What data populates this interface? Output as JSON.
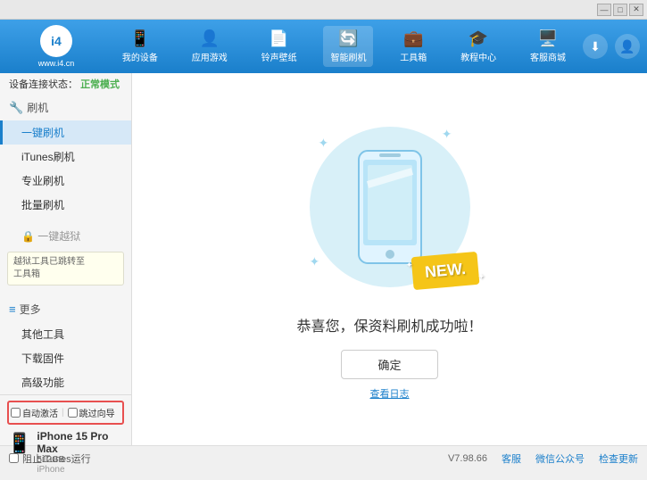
{
  "titlebar": {
    "btn_minimize": "—",
    "btn_restore": "□",
    "btn_close": "✕"
  },
  "header": {
    "logo_abbr": "i4",
    "logo_url": "www.i4.cn",
    "nav_items": [
      {
        "id": "my-device",
        "label": "我的设备",
        "icon": "📱"
      },
      {
        "id": "app-games",
        "label": "应用游戏",
        "icon": "👤"
      },
      {
        "id": "ringtone",
        "label": "铃声壁纸",
        "icon": "📄"
      },
      {
        "id": "smart-flash",
        "label": "智能刷机",
        "icon": "🔄",
        "active": true
      },
      {
        "id": "toolbox",
        "label": "工具箱",
        "icon": "💼"
      },
      {
        "id": "tutorial",
        "label": "教程中心",
        "icon": "🎓"
      },
      {
        "id": "service",
        "label": "客服商城",
        "icon": "🖥️"
      }
    ],
    "download_icon": "⬇",
    "user_icon": "👤"
  },
  "breadcrumb": {
    "label": "设备连接状态：",
    "status": "正常模式"
  },
  "sidebar": {
    "section_flash": {
      "label": "刷机",
      "icon": "🔧"
    },
    "items": [
      {
        "id": "one-key-flash",
        "label": "一键刷机",
        "active": true
      },
      {
        "id": "itunes-flash",
        "label": "iTunes刷机"
      },
      {
        "id": "pro-flash",
        "label": "专业刷机"
      },
      {
        "id": "batch-flash",
        "label": "批量刷机"
      }
    ],
    "disabled_item": {
      "label": "一键越狱",
      "icon": "🔒"
    },
    "disabled_note": "越狱工具已跳转至\n工具箱",
    "section_more": {
      "label": "更多",
      "icon": "≡"
    },
    "more_items": [
      {
        "id": "other-tools",
        "label": "其他工具"
      },
      {
        "id": "download-firmware",
        "label": "下载固件"
      },
      {
        "id": "advanced",
        "label": "高级功能"
      }
    ],
    "auto_activate_label": "自动激活",
    "auto_guide_label": "跳过向导",
    "device": {
      "name": "iPhone 15 Pro Max",
      "storage": "512GB",
      "type": "iPhone"
    }
  },
  "content": {
    "new_badge": "NEW.",
    "success_message": "恭喜您，保资料刷机成功啦！",
    "confirm_btn": "确定",
    "log_link": "查看日志"
  },
  "statusbar": {
    "stop_itunes_label": "阻止iTunes运行",
    "version": "V7.98.66",
    "link1": "客服",
    "link2": "微信公众号",
    "link3": "检查更新"
  }
}
